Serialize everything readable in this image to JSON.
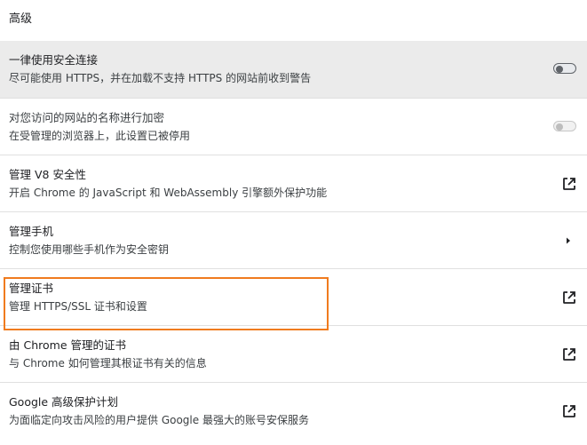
{
  "section": {
    "title": "高级"
  },
  "rows": [
    {
      "label": "一律使用安全连接",
      "sublabel": "尽可能使用 HTTPS，并在加载不支持 HTTPS 的网站前收到警告",
      "control": "toggle",
      "toggle_on": false
    },
    {
      "label": "对您访问的网站的名称进行加密",
      "sublabel": "在受管理的浏览器上，此设置已被停用",
      "control": "toggle",
      "toggle_on": false,
      "disabled": true
    },
    {
      "label": "管理 V8 安全性",
      "sublabel": "开启 Chrome 的 JavaScript 和 WebAssembly 引擎额外保护功能",
      "control": "open-in-new-icon"
    },
    {
      "label": "管理手机",
      "sublabel": "控制您使用哪些手机作为安全密钥",
      "control": "chevron-right-icon"
    },
    {
      "label": "管理证书",
      "sublabel": "管理 HTTPS/SSL 证书和设置",
      "control": "open-in-new-icon",
      "highlighted": true
    },
    {
      "label": "由 Chrome 管理的证书",
      "sublabel": "与 Chrome 如何管理其根证书有关的信息",
      "control": "open-in-new-icon"
    },
    {
      "label": "Google 高级保护计划",
      "sublabel": "为面临定向攻击风险的用户提供 Google 最强大的账号安保服务",
      "control": "open-in-new-icon"
    }
  ],
  "colors": {
    "highlight": "#f07b1e",
    "hover_row": "#ebebeb",
    "text": "#202124"
  }
}
